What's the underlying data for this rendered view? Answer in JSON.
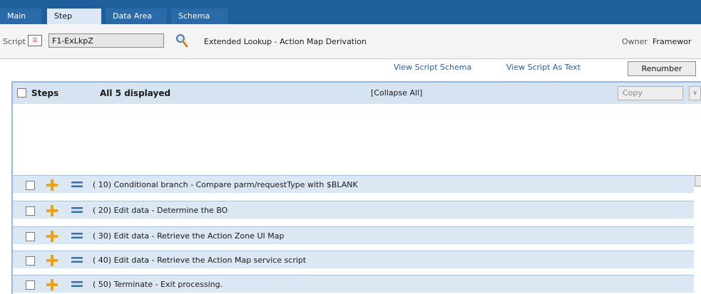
{
  "tabs": [
    {
      "label": "Main",
      "active": false
    },
    {
      "label": "Step",
      "active": true
    },
    {
      "label": "Data Area",
      "active": false
    },
    {
      "label": "Schema",
      "active": false
    }
  ],
  "script": {
    "label": "Script",
    "value": "F1-ExLkpZ",
    "description": "Extended Lookup - Action Map Derivation",
    "owner_label": "Owner",
    "owner_value": "Framewor"
  },
  "links": {
    "view_schema": "View Script Schema",
    "view_text": "View Script As Text",
    "renumber": "Renumber"
  },
  "steps_panel": {
    "title": "Steps",
    "count_text": "All 5 displayed",
    "collapse": "[Collapse All]",
    "copy": "Copy",
    "dropdown_glyph": "∨"
  },
  "steps": [
    {
      "seq": "( 10)",
      "text": "Conditional branch - Compare parm/requestType with $BLANK"
    },
    {
      "seq": "( 20)",
      "text": "Edit data - Determine the BO"
    },
    {
      "seq": "( 30)",
      "text": "Edit data - Retrieve the Action Zone UI Map"
    },
    {
      "seq": "( 40)",
      "text": "Edit data - Retrieve the Action Map service script"
    },
    {
      "seq": "( 50)",
      "text": "Terminate - Exit processing."
    }
  ],
  "icons": {
    "script_icon": "script-list-icon",
    "search": "magnifier-icon",
    "insert": "plus-cross-icon",
    "move": "equals-icon"
  },
  "colors": {
    "tabbar": "#1f5f9c",
    "active_tab": "#dce8f5",
    "link": "#2b5e9e",
    "row_bg": "#dbe7f3",
    "plus": "#e8a317"
  }
}
